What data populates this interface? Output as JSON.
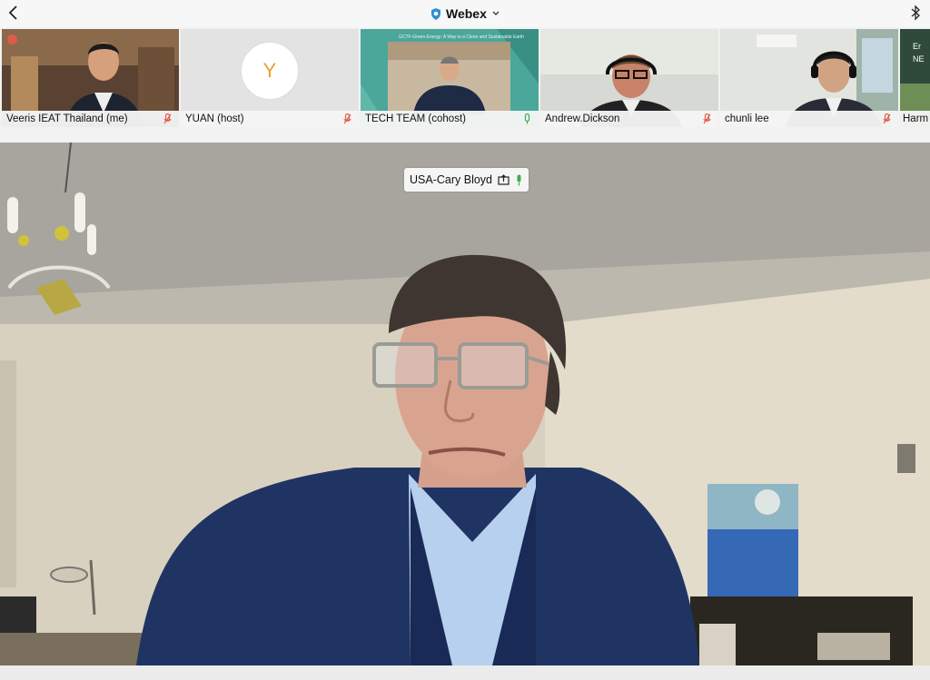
{
  "header": {
    "app_title": "Webex",
    "icons": [
      "chevron-left-icon",
      "shield-icon",
      "chevron-down-icon",
      "bluetooth-icon"
    ]
  },
  "participants": [
    {
      "name": "Veeris IEAT Thailand (me)",
      "muted": true,
      "recording_badge": true
    },
    {
      "name": "YUAN (host)",
      "muted": true,
      "avatar_letter": "Y"
    },
    {
      "name": "TECH TEAM (cohost)",
      "muted": false,
      "slide_title": "GCTF-Green Energy: A Way to a Clean and Sustainable Earth"
    },
    {
      "name": "Andrew.Dickson",
      "muted": true
    },
    {
      "name": "chunli lee",
      "muted": true
    },
    {
      "name": "Harm",
      "muted": false,
      "partial_text": "Er NE"
    }
  ],
  "main_speaker": {
    "name": "USA-Cary Bloyd",
    "sharing_icon": "share-icon",
    "mic_icon": "mic-active-icon"
  },
  "colors": {
    "mute_red": "#e05a4a",
    "mic_green": "#3cae4a",
    "avatar_letter": "#e3a429",
    "slide_teal": "#4aa79a"
  }
}
